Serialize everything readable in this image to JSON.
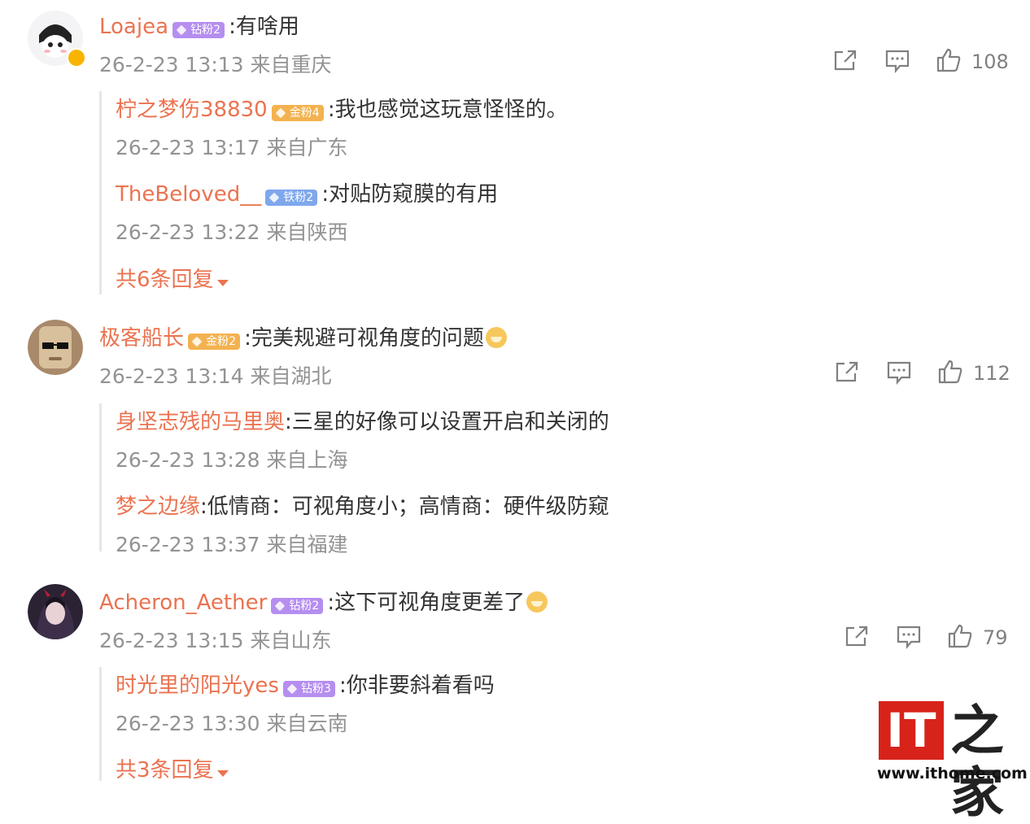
{
  "comments": [
    {
      "user": "Loajea",
      "badge": "钻粉2",
      "text": ":有啥用",
      "meta": "26-2-23 13:13 来自重庆",
      "likes": "108",
      "replies": [
        {
          "user": "柠之梦伤38830",
          "badge": "金粉4",
          "text": ":我也感觉这玩意怪怪的。",
          "meta": "26-2-23 13:17 来自广东"
        },
        {
          "user": "TheBeloved__",
          "badge": "铁粉2",
          "text": ":对贴防窥膜的有用",
          "meta": "26-2-23 13:22 来自陕西"
        }
      ],
      "more": "共6条回复"
    },
    {
      "user": "极客船长",
      "badge": "金粉2",
      "text": ":完美规避可视角度的问题",
      "meta": "26-2-23 13:14 来自湖北",
      "likes": "112",
      "replies": [
        {
          "user": "身坚志残的马里奥",
          "text": ":三星的好像可以设置开启和关闭的",
          "meta": "26-2-23 13:28 来自上海"
        },
        {
          "user": "梦之边缘",
          "text": ":低情商：可视角度小；高情商：硬件级防窥",
          "meta": "26-2-23 13:37 来自福建"
        }
      ]
    },
    {
      "user": "Acheron_Aether",
      "badge": "钻粉2",
      "text": ":这下可视角度更差了",
      "meta": "26-2-23 13:15 来自山东",
      "likes": "79",
      "replies": [
        {
          "user": "时光里的阳光yes",
          "badge": "钻粉3",
          "text": ":你非要斜着看吗",
          "meta": "26-2-23 13:30 来自云南"
        }
      ],
      "more": "共3条回复"
    }
  ],
  "watermark": {
    "brand": "IT",
    "brand_cn": "之家",
    "url": "www.ithome.com"
  },
  "colors": {
    "username": "#eb7350",
    "meta": "#939393",
    "text": "#333333",
    "icon": "#808080",
    "brand_red": "#d7231a"
  }
}
